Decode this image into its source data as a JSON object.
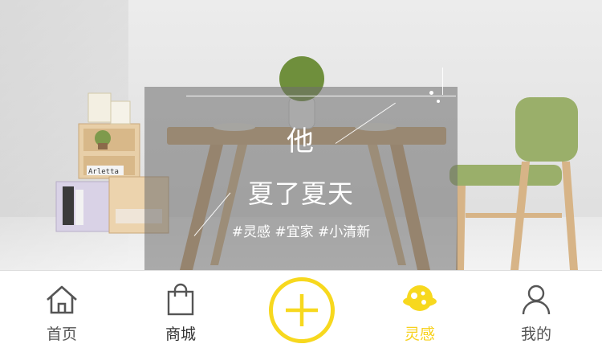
{
  "hero": {
    "overlay_title": "他",
    "overlay_subtitle": "夏了夏天",
    "overlay_tags": "#灵感 #宜家 #小清新",
    "shelf_label": "Arletta"
  },
  "tabbar": {
    "tabs": [
      {
        "label": "首页",
        "icon": "home-icon",
        "active": false
      },
      {
        "label": "商城",
        "icon": "shopping-bag-icon",
        "active": false
      },
      {
        "label": "",
        "icon": "plus-icon",
        "active": false
      },
      {
        "label": "灵感",
        "icon": "planet-icon",
        "active": true
      },
      {
        "label": "我的",
        "icon": "user-icon",
        "active": false
      }
    ]
  },
  "colors": {
    "accent": "#f7d81e",
    "tab_text": "#555555",
    "chair_seat": "#9aaf6a",
    "wood": "#d9b98e"
  }
}
